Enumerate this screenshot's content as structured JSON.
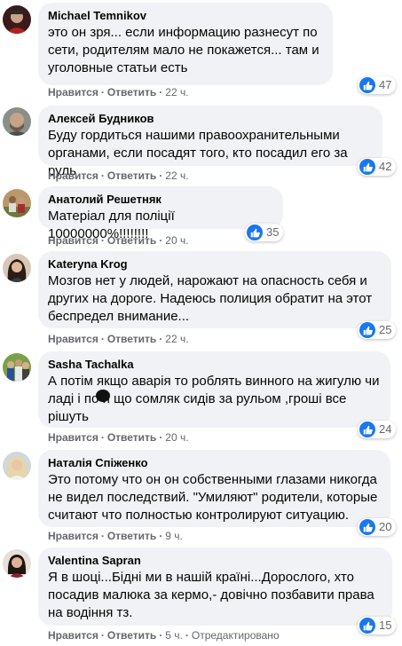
{
  "actions": {
    "like": "Нравится",
    "reply": "Ответить",
    "edited": "Отредактировано"
  },
  "comments": [
    {
      "name": "Michael Temnikov",
      "text": "это он зря... если информацию разнесут по сети, родителям мало не покажется... там и уголовные статьи есть",
      "time": "22 ч.",
      "reactions": "47"
    },
    {
      "name": "Алексей Будников",
      "text": "Буду гордиться нашими правоохранительными органами, если посадят того, кто посадил его за руль",
      "time": "22 ч.",
      "reactions": "42"
    },
    {
      "name": "Анатолий Решетняк",
      "text": "Матеріал для поліції 10000000%!!!!!!!!",
      "time": "20 ч.",
      "reactions": "35"
    },
    {
      "name": "Kateryna Krog",
      "text": "Мозгов нет у людей, нарожают на опасность себя и других на дороге. Надеюсь полиция обратит на этот беспредел внимание...",
      "time": "22 ч.",
      "reactions": "25"
    },
    {
      "name": "Sasha Tachalka",
      "text": "А потім якщо аварія то роблять винного на жигулю чи ладі і по й що сомляк сидів за рульом ,гроші все рішуть",
      "time": "20 ч.",
      "reactions": "24"
    },
    {
      "name": "Наталія Спіженко",
      "text": "Это потому что он он собственными глазами никогда не видел последствий. \"Умиляют\" родители, которые считают что полностью контролируют ситуацию.",
      "time": "9 ч.",
      "reactions": "20"
    },
    {
      "name": "Valentina Sapran",
      "text": "Я в шоці...Бідні ми в нашій країні...Дорослого, хто посадив малюка за кермо,- довічно позбавити права на водіння тз.",
      "time": "5 ч.",
      "reactions": "15"
    }
  ]
}
